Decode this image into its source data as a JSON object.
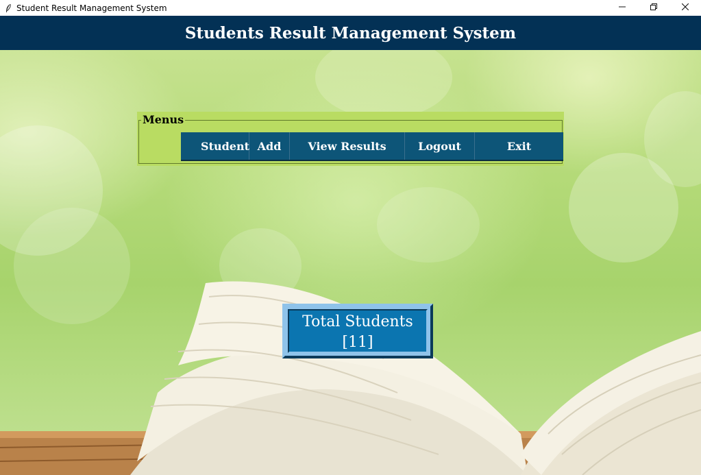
{
  "window": {
    "title": "Student Result Management System",
    "controls": {
      "minimize": "—",
      "restore": "❐",
      "close": "✕"
    }
  },
  "header": {
    "title": "Students Result Management System"
  },
  "menus": {
    "legend": "Menus",
    "items": [
      {
        "label": "Student"
      },
      {
        "label": "Add"
      },
      {
        "label": "View Results"
      },
      {
        "label": "Logout"
      },
      {
        "label": "Exit"
      }
    ]
  },
  "summary": {
    "label": "Total Students",
    "count": "[11]"
  },
  "icons": {
    "app": "feather-icon",
    "minimize": "minimize-icon",
    "restore": "restore-icon",
    "close": "close-icon"
  },
  "colors": {
    "header_bg": "#033155",
    "menu_bg": "#0b4f73",
    "menu_frame_bg": "#b9dc62",
    "summary_bg": "#0b75b0"
  }
}
